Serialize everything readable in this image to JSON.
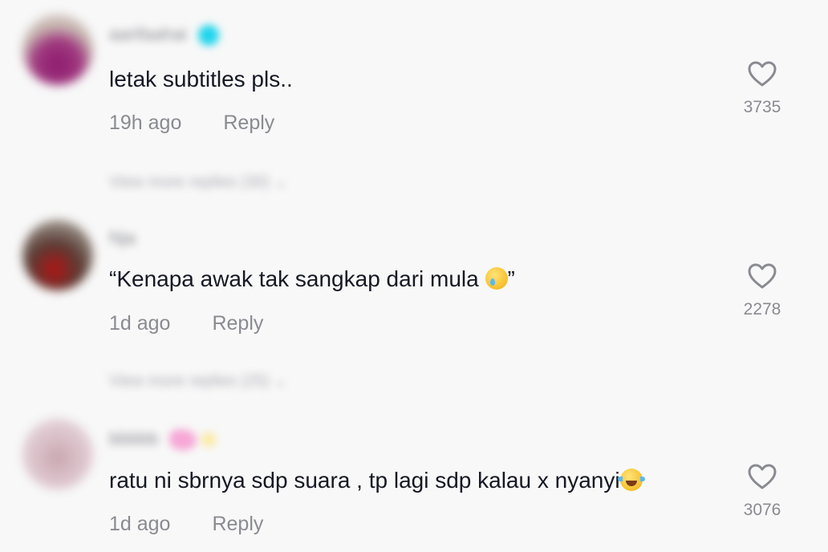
{
  "comments": [
    {
      "username": "aarifaahai",
      "text": "letak subtitles pls..",
      "time": "19h ago",
      "reply_label": "Reply",
      "likes": "3735",
      "view_replies": "View more replies (30)"
    },
    {
      "username": "Nja",
      "text": "“Kenapa awak tak sangkap dari mula ",
      "text_end": "”",
      "time": "1d ago",
      "reply_label": "Reply",
      "likes": "2278",
      "view_replies": "View more replies (25)"
    },
    {
      "username": "bbbbb",
      "text": "ratu ni sbrnya sdp suara , tp lagi sdp kalau x nyanyi",
      "time": "1d ago",
      "reply_label": "Reply",
      "likes": "3076"
    }
  ],
  "icons": {
    "like": "heart-outline-icon",
    "emoji_1": "crying-face-emoji",
    "emoji_2": "tears-of-joy-emoji"
  },
  "colors": {
    "background": "#f8f8f8",
    "text": "#161823",
    "secondary": "#8a8b91",
    "verified": "#20d5ec"
  }
}
